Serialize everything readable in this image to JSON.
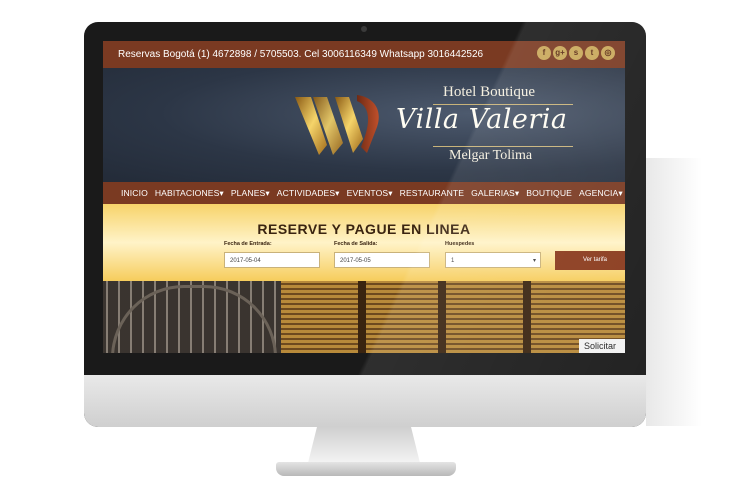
{
  "topbar": {
    "contact": "Reservas Bogotá (1) 4672898 / 5705503.  Cel 3006116349 Whatsapp 3016442526",
    "social_icons": [
      "facebook-icon",
      "google-plus-icon",
      "skype-icon",
      "twitter-icon",
      "instagram-icon"
    ],
    "social_glyphs": [
      "f",
      "g+",
      "s",
      "t",
      "◎"
    ]
  },
  "brand": {
    "top": "Hotel Boutique",
    "main": "Villa Valeria",
    "sub": "Melgar Tolima"
  },
  "nav": {
    "items": [
      "INICIO",
      "HABITACIONES▾",
      "PLANES▾",
      "ACTIVIDADES▾",
      "EVENTOS▾",
      "RESTAURANTE",
      "GALERIAS▾",
      "BOUTIQUE",
      "AGENCIA▾"
    ]
  },
  "booking": {
    "title": "RESERVE Y PAGUE EN LINEA",
    "checkin_label": "Fecha de Entrada:",
    "checkin_value": "2017-05-04",
    "checkout_label": "Fecha de Salida:",
    "checkout_value": "2017-05-05",
    "guests_label": "Huespedes",
    "guests_value": "1",
    "rate_button": "Ver tarifa"
  },
  "photo": {
    "request_label": "Solicitar"
  },
  "colors": {
    "brand_brown": "#7a3a22",
    "gold": "#f6cd5c",
    "header_dark": "#2c3646"
  }
}
